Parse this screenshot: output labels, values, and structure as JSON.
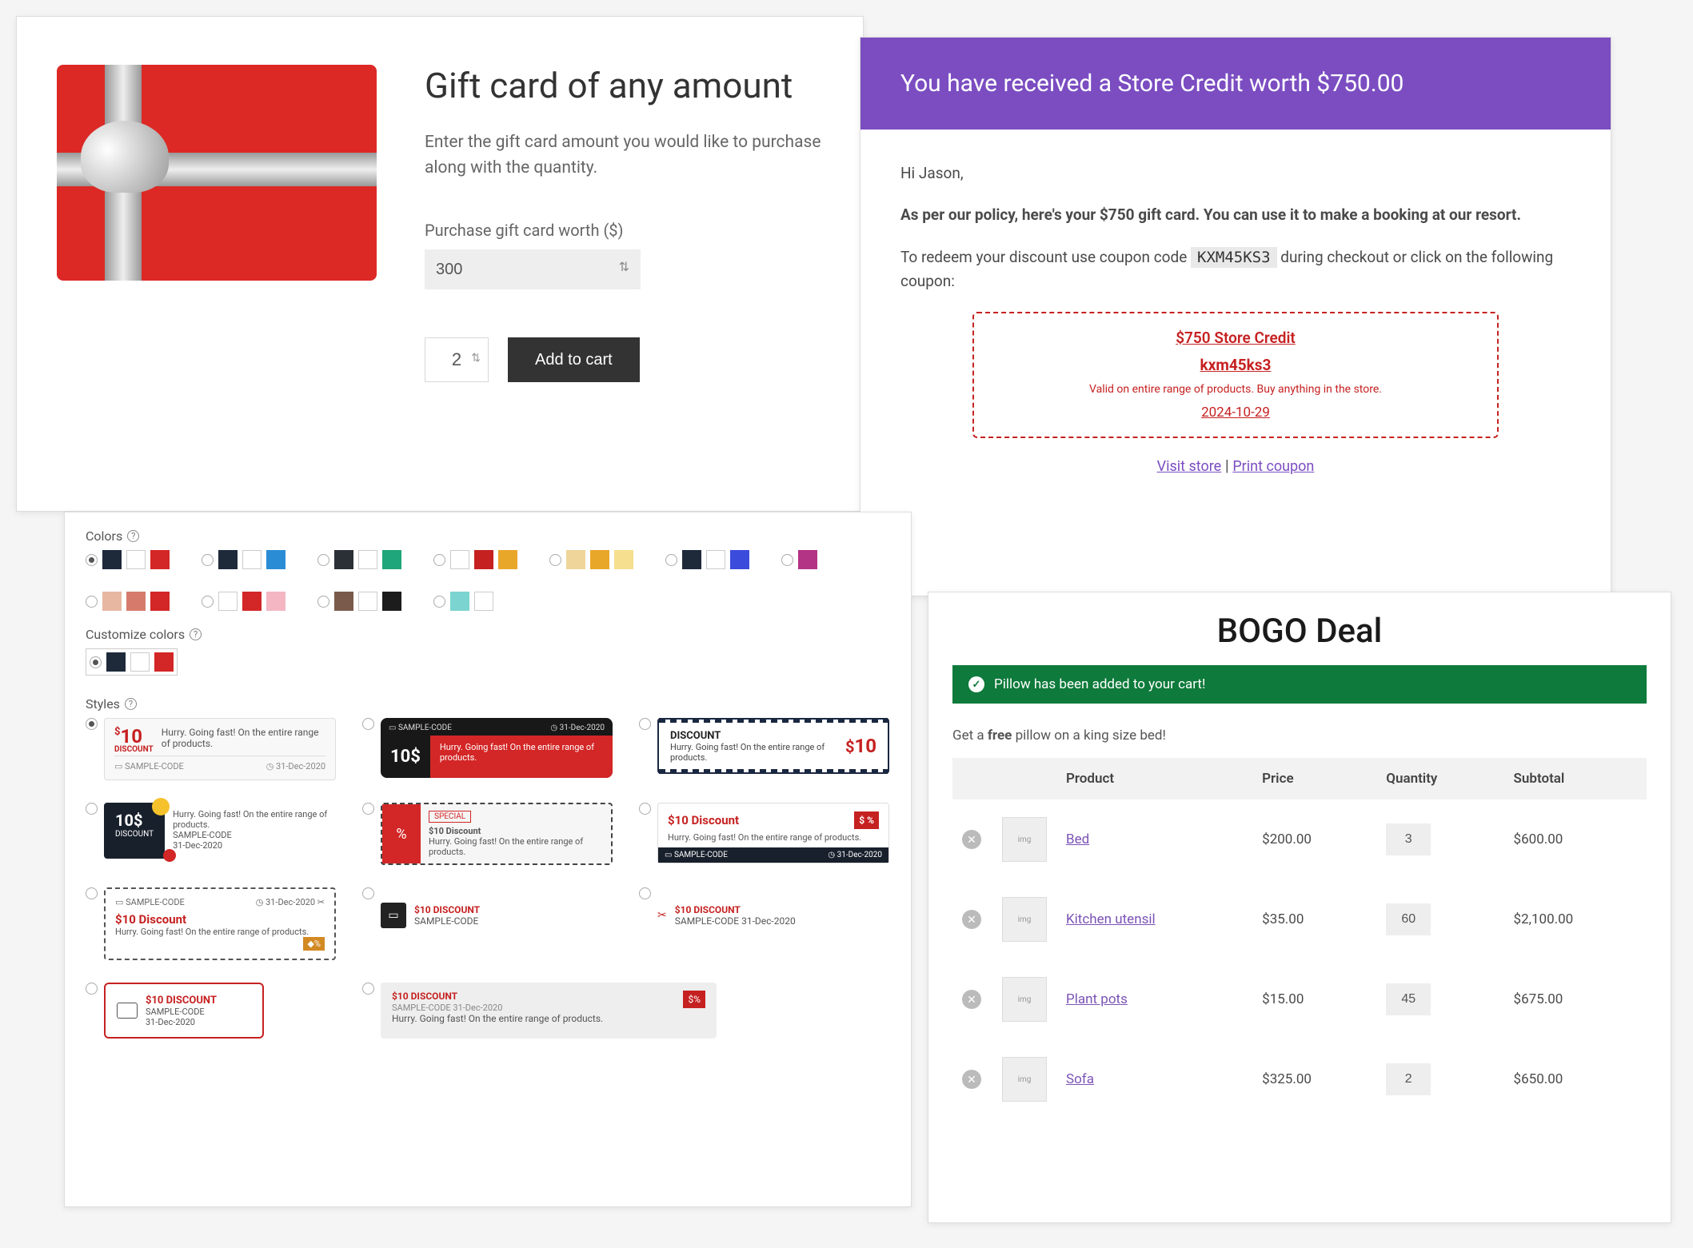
{
  "gift": {
    "title": "Gift card of any amount",
    "desc": "Enter the gift card amount you would like to purchase along with the quantity.",
    "amount_label": "Purchase gift card worth ($)",
    "amount_value": "300",
    "qty_value": "2",
    "add_button": "Add to cart"
  },
  "email": {
    "header": "You have received a Store Credit worth $750.00",
    "greeting": "Hi Jason,",
    "line1": "As per our policy, here's your $750 gift card. You can use it to make a booking at our resort.",
    "line2a": "To redeem your discount use coupon code ",
    "code": "KXM45KS3",
    "line2b": " during checkout or click on the following coupon:",
    "coupon_title": "$750 Store Credit",
    "coupon_code": "kxm45ks3",
    "coupon_desc": "Valid on entire range of products. Buy anything in the store.",
    "coupon_date": "2024-10-29",
    "link_visit": "Visit store",
    "link_print": "Print coupon"
  },
  "styles": {
    "label_colors": "Colors",
    "label_customize": "Customize colors",
    "label_styles": "Styles",
    "swatches": [
      [
        "#1e2a3a",
        "#ffffff",
        "#d32626"
      ],
      [
        "#1e2a3a",
        "#ffffff",
        "#2b8cd6"
      ],
      [
        "#2b2f36",
        "#ffffff",
        "#1fa67a"
      ],
      [
        "#ffffff",
        "#c62121",
        "#e9a72a"
      ],
      [
        "#efd59a",
        "#e9a72a",
        "#f6df8e"
      ],
      [
        "#1e2a3a",
        "#ffffff",
        "#3b4bdc"
      ],
      [
        "#b33384"
      ],
      [
        "#e7b7a1",
        "#d67b6c",
        "#d32626"
      ],
      [
        "#ffffff",
        "#d32626",
        "#f4b6c3"
      ],
      [
        "#7a5a4a",
        "#ffffff",
        "#1c1c1c"
      ],
      [
        "#7bd4d0",
        "#ffffff"
      ]
    ],
    "customize": [
      "#1e2a3a",
      "#ffffff",
      "#d32626"
    ],
    "tile_amount": "10",
    "tile_amount_label": "$10",
    "tile_discount_word": "DISCOUNT",
    "tile_discount_title": "$10 Discount",
    "tile_discount_title_caps": "$10 DISCOUNT",
    "tile_text": "Hurry. Going fast! On the entire range of products.",
    "tile_code": "SAMPLE-CODE",
    "tile_date": "31-Dec-2020",
    "tile_special": "SPECIAL"
  },
  "bogo": {
    "title": "BOGO Deal",
    "success": "Pillow has been added to your cart!",
    "promo_a": "Get a ",
    "promo_b": "free",
    "promo_c": " pillow on a king size bed!",
    "cols": {
      "product": "Product",
      "price": "Price",
      "qty": "Quantity",
      "subtotal": "Subtotal"
    },
    "rows": [
      {
        "name": "Bed",
        "price": "$200.00",
        "qty": "3",
        "subtotal": "$600.00"
      },
      {
        "name": "Kitchen utensil",
        "price": "$35.00",
        "qty": "60",
        "subtotal": "$2,100.00"
      },
      {
        "name": "Plant pots",
        "price": "$15.00",
        "qty": "45",
        "subtotal": "$675.00"
      },
      {
        "name": "Sofa",
        "price": "$325.00",
        "qty": "2",
        "subtotal": "$650.00"
      }
    ]
  }
}
